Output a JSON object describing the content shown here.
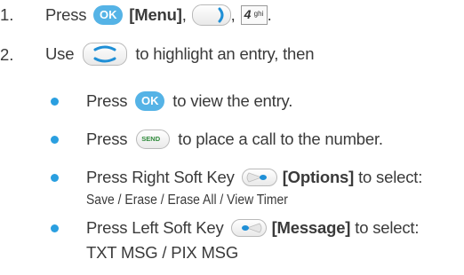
{
  "colors": {
    "bullet": "#2a9fe0",
    "ok_key": "#55b3e6",
    "send_text": "#2e8a3a",
    "text": "#3a3a3a"
  },
  "icons": {
    "ok": "ok-key-icon",
    "nav_right": "nav-right-key-icon",
    "number_4": "key-4-ghi-icon",
    "nav_updown": "nav-up-down-key-icon",
    "send": "send-key-icon",
    "right_soft": "right-soft-key-icon",
    "left_soft": "left-soft-key-icon"
  },
  "step1": {
    "number": "1.",
    "press": "Press",
    "ok_label": "OK",
    "menu": "[Menu]",
    "comma1": ",",
    "comma2": ",",
    "key4_digit": "4",
    "key4_letters": "ghi",
    "period": "."
  },
  "step2": {
    "number": "2.",
    "use": "Use",
    "rest": "to highlight an entry, then"
  },
  "bullets": {
    "b1": {
      "press": "Press",
      "ok_label": "OK",
      "rest": "to view the entry."
    },
    "b2": {
      "press": "Press",
      "send_label": "SEND",
      "rest": "to place a call to the number."
    },
    "b3": {
      "text": "Press Right Soft Key",
      "bold": "[Options]",
      "rest": "to select:",
      "line2": "Save / Erase / Erase All / View Timer"
    },
    "b4": {
      "text": "Press Left Soft Key",
      "bold": "[Message]",
      "rest": "to select:",
      "line2": "TXT MSG / PIX MSG"
    }
  }
}
